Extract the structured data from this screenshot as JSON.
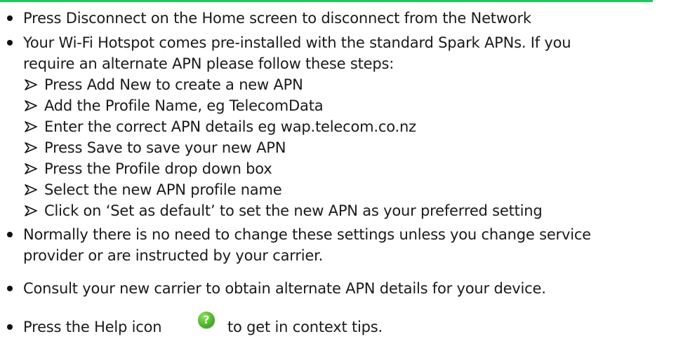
{
  "accent_color": "#22c55e",
  "help_icon": {
    "name": "help-icon",
    "glyph": "?",
    "color": "#4fb52a"
  },
  "bullets": [
    {
      "lines": [
        "Press Disconnect on the Home screen to disconnect from the Network"
      ]
    },
    {
      "lines": [
        "Your Wi-Fi Hotspot comes pre-installed with the standard Spark APNs. If you",
        "require an alternate APN please follow these steps:"
      ],
      "steps": [
        "Press Add New to create a new APN",
        "Add the Profile Name, eg TelecomData",
        "Enter the correct APN details eg wap.telecom.co.nz",
        "Press Save to save your new APN",
        "Press the Profile drop down box",
        "Select the new APN profile name",
        "Click on ‘Set as default’ to set the new APN as your preferred setting"
      ]
    },
    {
      "lines": [
        "Normally there is no need to change these settings unless you change service",
        "provider or are instructed by your carrier."
      ]
    },
    {
      "lines": [
        "Consult your new carrier to obtain alternate APN details for your device."
      ]
    },
    {
      "before_icon": "Press the Help icon",
      "after_icon": "to get in context tips."
    }
  ]
}
